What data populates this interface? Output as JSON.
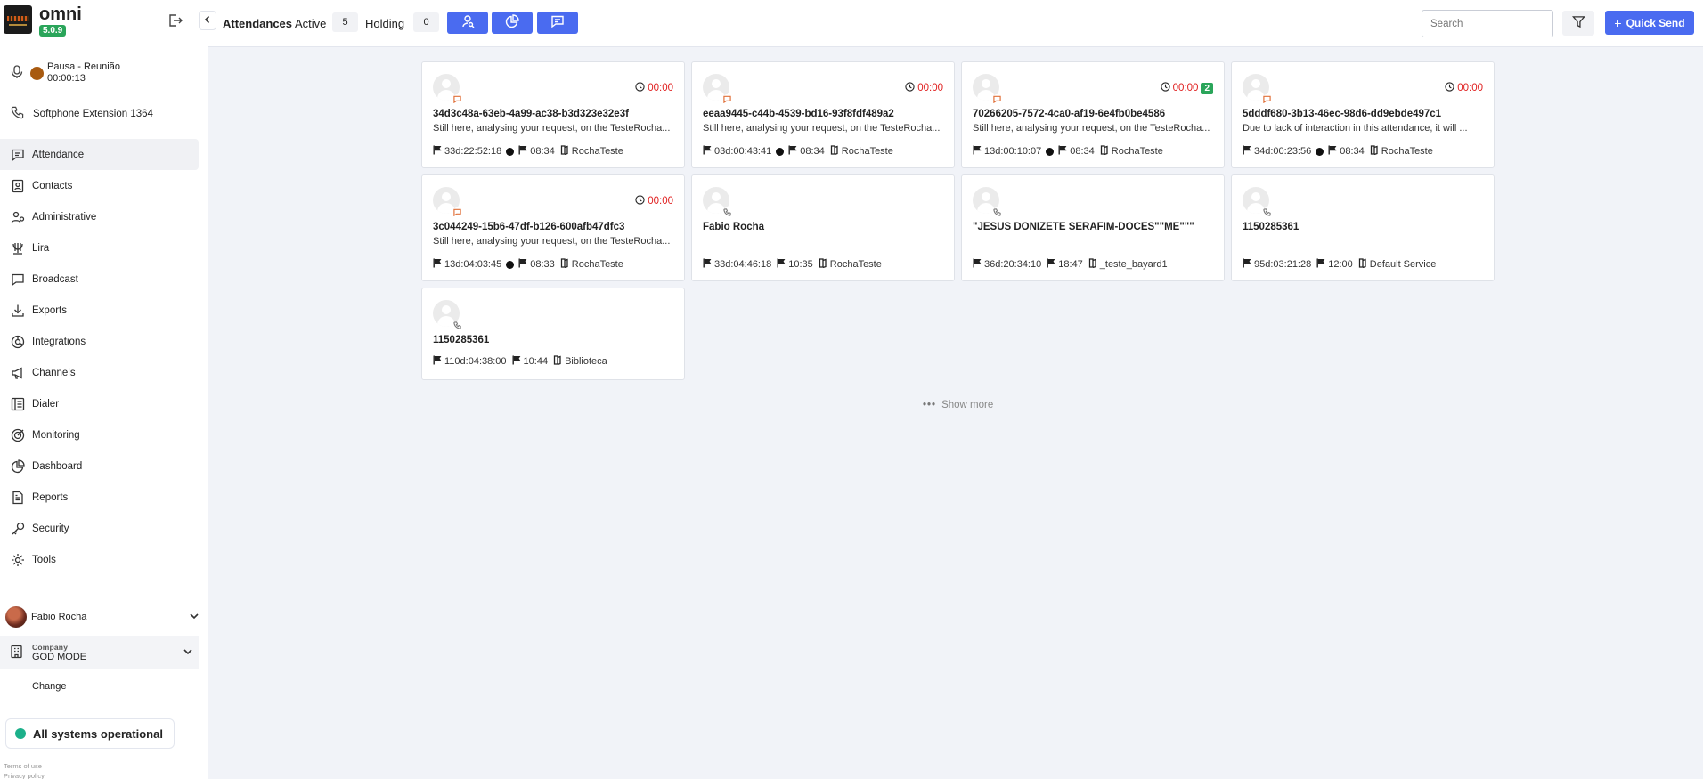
{
  "brand": {
    "name": "omni",
    "version": "5.0.9"
  },
  "agent_status": {
    "label": "Pausa - Reunião",
    "time": "00:00:13"
  },
  "softphone": {
    "label": "Softphone Extension 1364"
  },
  "nav": {
    "items": [
      {
        "label": "Attendance",
        "icon": "chat-icon"
      },
      {
        "label": "Contacts",
        "icon": "contacts-icon"
      },
      {
        "label": "Administrative",
        "icon": "admin-icon"
      },
      {
        "label": "Lira",
        "icon": "lira-icon"
      },
      {
        "label": "Broadcast",
        "icon": "broadcast-icon"
      },
      {
        "label": "Exports",
        "icon": "download-icon"
      },
      {
        "label": "Integrations",
        "icon": "integrations-icon"
      },
      {
        "label": "Channels",
        "icon": "megaphone-icon"
      },
      {
        "label": "Dialer",
        "icon": "dialer-icon"
      },
      {
        "label": "Monitoring",
        "icon": "target-icon"
      },
      {
        "label": "Dashboard",
        "icon": "pie-chart-icon"
      },
      {
        "label": "Reports",
        "icon": "report-icon"
      },
      {
        "label": "Security",
        "icon": "key-icon"
      },
      {
        "label": "Tools",
        "icon": "gear-icon"
      }
    ]
  },
  "user": {
    "name": "Fabio Rocha"
  },
  "company": {
    "label": "Company",
    "name": "GOD MODE",
    "change_label": "Change"
  },
  "system_status": {
    "label": "All systems operational",
    "color": "#1cb08a"
  },
  "footer": {
    "terms": "Terms of use",
    "privacy": "Privacy policy"
  },
  "header": {
    "title": "Attendances",
    "active_label": "Active",
    "active_count": "5",
    "holding_label": "Holding",
    "holding_count": "0",
    "search_placeholder": "Search",
    "quick_send_label": "Quick Send",
    "accent": "#4a6bf0"
  },
  "cards": [
    {
      "name": "34d3c48a-63eb-4a99-ac38-b3d323e32e3f",
      "message": "Still here, analysing your request, on the TesteRocha...",
      "timer": "00:00",
      "unread": "",
      "channel": "chat",
      "duration": "33d:22:52:18",
      "online": true,
      "time": "08:34",
      "queue": "RochaTeste"
    },
    {
      "name": "eeaa9445-c44b-4539-bd16-93f8fdf489a2",
      "message": "Still here, analysing your request, on the TesteRocha...",
      "timer": "00:00",
      "unread": "",
      "channel": "chat",
      "duration": "03d:00:43:41",
      "online": true,
      "time": "08:34",
      "queue": "RochaTeste"
    },
    {
      "name": "70266205-7572-4ca0-af19-6e4fb0be4586",
      "message": "Still here, analysing your request, on the TesteRocha...",
      "timer": "00:00",
      "unread": "2",
      "channel": "chat",
      "duration": "13d:00:10:07",
      "online": true,
      "time": "08:34",
      "queue": "RochaTeste"
    },
    {
      "name": "5dddf680-3b13-46ec-98d6-dd9ebde497c1",
      "message": "Due to lack of interaction in this attendance, it will ...",
      "timer": "00:00",
      "unread": "",
      "channel": "chat",
      "duration": "34d:00:23:56",
      "online": true,
      "time": "08:34",
      "queue": "RochaTeste"
    },
    {
      "name": "3c044249-15b6-47df-b126-600afb47dfc3",
      "message": "Still here, analysing your request, on the TesteRocha...",
      "timer": "00:00",
      "unread": "",
      "channel": "chat",
      "duration": "13d:04:03:45",
      "online": true,
      "time": "08:33",
      "queue": "RochaTeste"
    },
    {
      "name": "Fabio Rocha",
      "message": "",
      "timer": "",
      "unread": "",
      "channel": "phone",
      "duration": "33d:04:46:18",
      "online": false,
      "time": "10:35",
      "queue": "RochaTeste"
    },
    {
      "name": "\"JESUS DONIZETE SERAFIM-DOCES\"\"ME\"\"\"",
      "message": "",
      "timer": "",
      "unread": "",
      "channel": "phone",
      "duration": "36d:20:34:10",
      "online": false,
      "time": "18:47",
      "queue": "_teste_bayard1"
    },
    {
      "name": "1150285361",
      "message": "",
      "timer": "",
      "unread": "",
      "channel": "phone",
      "duration": "95d:03:21:28",
      "online": false,
      "time": "12:00",
      "queue": "Default Service"
    },
    {
      "name": "1150285361",
      "message": "",
      "timer": "",
      "unread": "",
      "channel": "phone",
      "duration": "110d:04:38:00",
      "online": false,
      "time": "10:44",
      "queue": "Biblioteca"
    }
  ],
  "show_more_label": "Show more"
}
